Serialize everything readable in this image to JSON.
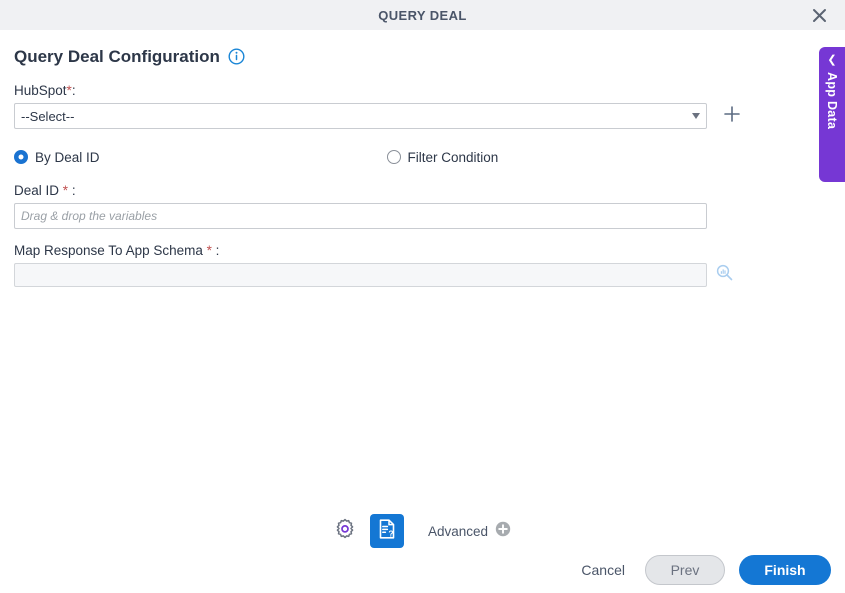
{
  "window": {
    "title": "QUERY DEAL",
    "close_icon": "close-icon"
  },
  "form": {
    "heading": "Query Deal Configuration",
    "info_icon": "info-circle-icon",
    "hubspot": {
      "label": "HubSpot",
      "required_mark": "*",
      "colon": ":",
      "selected_value": "--Select--",
      "caret_icon": "chevron-down-icon",
      "add_icon": "plus-icon"
    },
    "query_mode": {
      "options": [
        {
          "label": "By Deal ID",
          "selected": true
        },
        {
          "label": "Filter Condition",
          "selected": false
        }
      ]
    },
    "deal_id": {
      "label": "Deal ID",
      "required_mark": "*",
      "colon": ":",
      "value": "",
      "placeholder": "Drag & drop the variables"
    },
    "map_response": {
      "label": "Map Response To App Schema",
      "required_mark": "*",
      "colon": ":",
      "value": "",
      "search_icon": "magnifier-chart-icon"
    }
  },
  "side_panel": {
    "label": "App Data",
    "chevron_icon": "chevron-left-icon",
    "color": "#7637d4"
  },
  "toolbar": {
    "settings_icon": "gear-icon",
    "help_doc_icon": "document-question-icon",
    "advanced_label": "Advanced",
    "advanced_add_icon": "plus-circle-icon"
  },
  "actions": {
    "cancel_label": "Cancel",
    "prev_label": "Prev",
    "finish_label": "Finish",
    "accent_color": "#1477d4"
  }
}
